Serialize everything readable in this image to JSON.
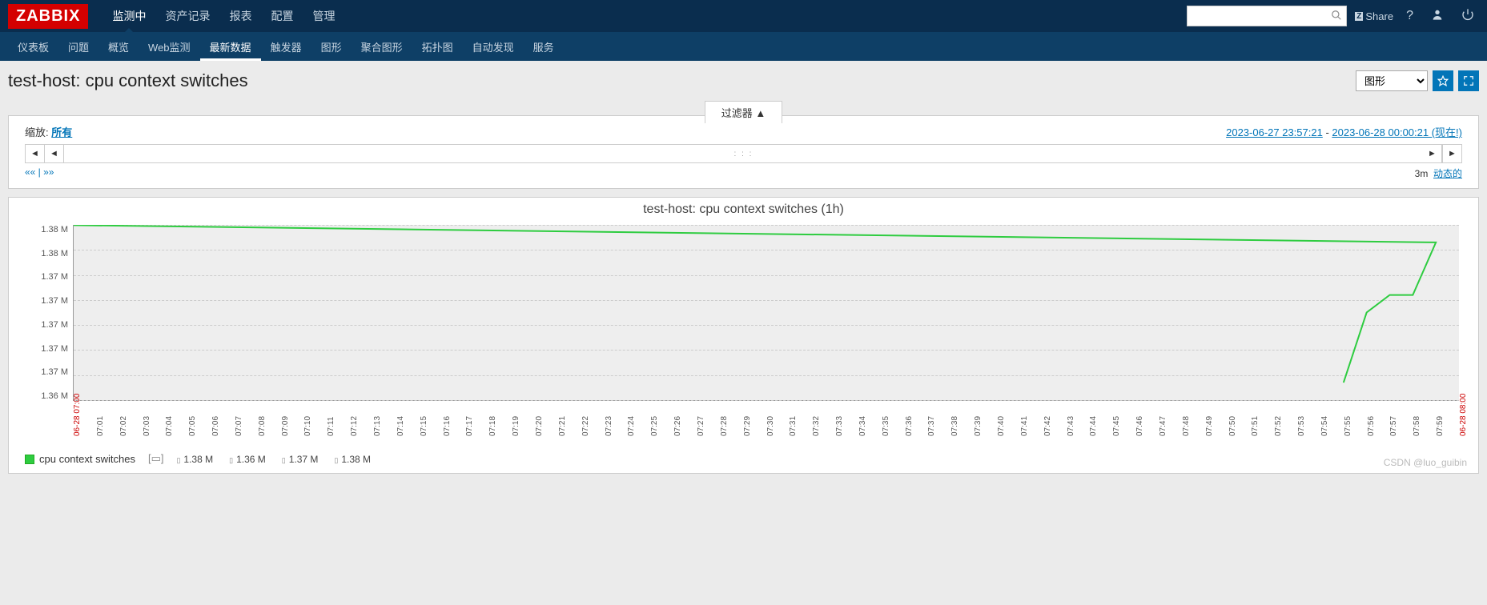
{
  "logo": "ZABBIX",
  "topnav": [
    "监测中",
    "资产记录",
    "报表",
    "配置",
    "管理"
  ],
  "topnav_active": 0,
  "share": "Share",
  "subnav": [
    "仪表板",
    "问题",
    "概览",
    "Web监测",
    "最新数据",
    "触发器",
    "图形",
    "聚合图形",
    "拓扑图",
    "自动发现",
    "服务"
  ],
  "subnav_active": 4,
  "page_title": "test-host: cpu context switches",
  "view_select": "图形",
  "filter_tab": "过滤器 ▲",
  "zoom_label": "缩放:",
  "zoom_value": "所有",
  "date_from": "2023-06-27 23:57:21",
  "date_to": "2023-06-28 00:00:21 (现在!)",
  "nav_ll": "«« | »»",
  "nav_rr_time": "3m",
  "nav_rr_link": "动态的",
  "chart_title": "test-host: cpu context switches (1h)",
  "chart_data": {
    "type": "line",
    "title": "test-host: cpu context switches (1h)",
    "ylabel": "",
    "ylim": [
      1.36,
      1.38
    ],
    "y_ticks": [
      "1.38 M",
      "1.38 M",
      "1.37 M",
      "1.37 M",
      "1.37 M",
      "1.37 M",
      "1.37 M",
      "1.36 M"
    ],
    "x_ticks": [
      "06-28 07:00",
      "07:01",
      "07:02",
      "07:03",
      "07:04",
      "07:05",
      "07:06",
      "07:07",
      "07:08",
      "07:09",
      "07:10",
      "07:11",
      "07:12",
      "07:13",
      "07:14",
      "07:15",
      "07:16",
      "07:17",
      "07:18",
      "07:19",
      "07:20",
      "07:21",
      "07:22",
      "07:23",
      "07:24",
      "07:25",
      "07:26",
      "07:27",
      "07:28",
      "07:29",
      "07:30",
      "07:31",
      "07:32",
      "07:33",
      "07:34",
      "07:35",
      "07:36",
      "07:37",
      "07:38",
      "07:39",
      "07:40",
      "07:41",
      "07:42",
      "07:43",
      "07:44",
      "07:45",
      "07:46",
      "07:47",
      "07:48",
      "07:49",
      "07:50",
      "07:51",
      "07:52",
      "07:53",
      "07:54",
      "07:55",
      "07:56",
      "07:57",
      "07:58",
      "07:59",
      "06-28 08:00"
    ],
    "series": [
      {
        "name": "cpu context switches",
        "color": "#2ecc40",
        "x": [
          "07:55",
          "07:56",
          "07:57",
          "07:58",
          "07:59",
          "08:00"
        ],
        "values": [
          1.362,
          1.37,
          1.372,
          1.372,
          1.378,
          1.38
        ]
      }
    ]
  },
  "legend_name": "cpu context switches",
  "legend_stats": [
    "1.38 M",
    "1.36 M",
    "1.37 M",
    "1.38 M"
  ],
  "watermark": "CSDN @luo_guibin"
}
